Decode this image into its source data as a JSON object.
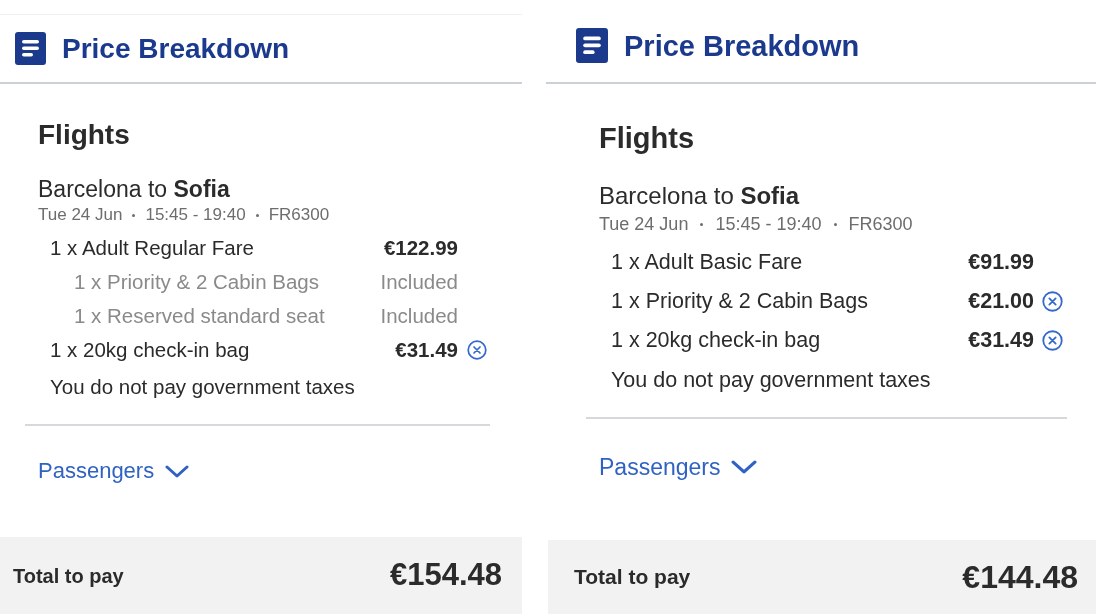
{
  "panels": [
    {
      "title": "Price Breakdown",
      "section_title": "Flights",
      "flight": {
        "route": "Barcelona to **Sofia**",
        "date": "Tue 24 Jun",
        "time": "15:45 - 19:40",
        "flight_number": "FR6300"
      },
      "items": [
        {
          "kind": "charge",
          "description": "1 x Adult Regular Fare",
          "price": "€122.99",
          "removable": false
        },
        {
          "kind": "included",
          "description": "1 x Priority & 2 Cabin Bags",
          "price": "Included",
          "removable": false
        },
        {
          "kind": "included",
          "description": "1 x Reserved standard seat",
          "price": "Included",
          "removable": false
        },
        {
          "kind": "charge",
          "description": "1 x 20kg check-in bag",
          "price": "€31.49",
          "removable": true
        }
      ],
      "note": "You do not pay government taxes",
      "passengers": {
        "label": "Passengers",
        "expanded": false
      },
      "total": {
        "label": "Total to pay",
        "amount": "€154.48"
      }
    },
    {
      "title": "Price Breakdown",
      "section_title": "Flights",
      "flight": {
        "route": "Barcelona to **Sofia**",
        "date": "Tue 24 Jun",
        "time": "15:45 - 19:40",
        "flight_number": "FR6300"
      },
      "items": [
        {
          "kind": "charge",
          "description": "1 x Adult Basic Fare",
          "price": "€91.99",
          "removable": false
        },
        {
          "kind": "charge",
          "description": "1 x Priority & 2 Cabin Bags",
          "price": "€21.00",
          "removable": true
        },
        {
          "kind": "charge",
          "description": "1 x 20kg check-in bag",
          "price": "€31.49",
          "removable": true
        }
      ],
      "note": "You do not pay government taxes",
      "passengers": {
        "label": "Passengers",
        "expanded": false
      },
      "total": {
        "label": "Total to pay",
        "amount": "€144.48"
      }
    }
  ]
}
